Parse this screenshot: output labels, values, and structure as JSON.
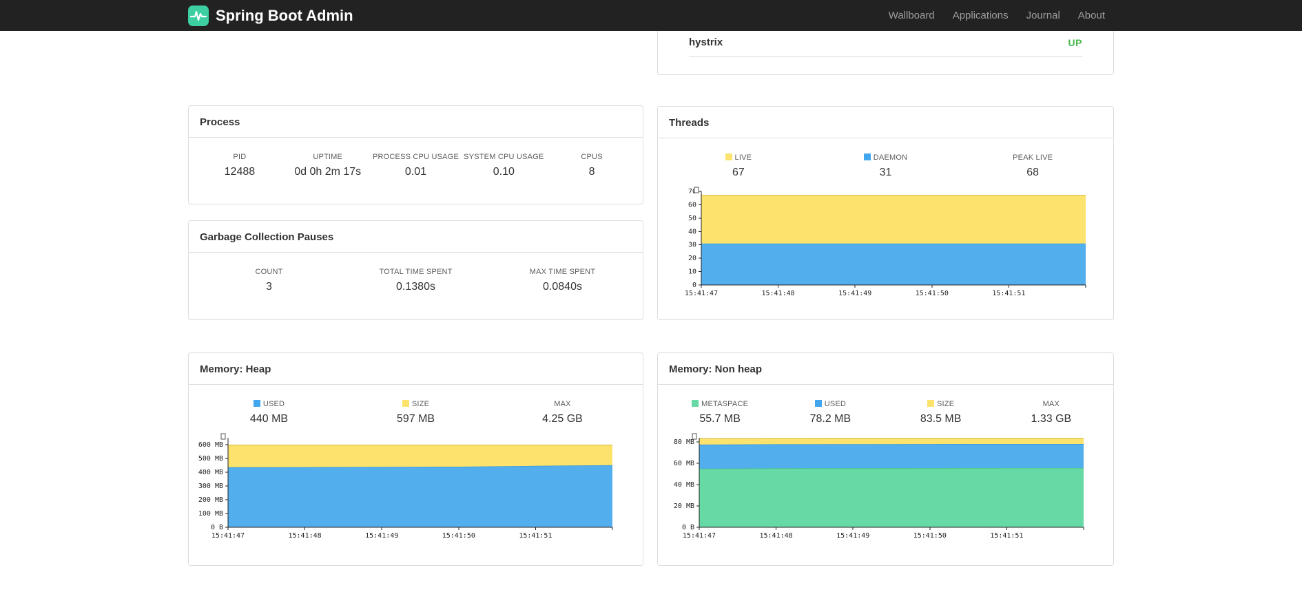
{
  "navbar": {
    "brand": "Spring Boot Admin",
    "links": [
      {
        "label": "Wallboard"
      },
      {
        "label": "Applications"
      },
      {
        "label": "Journal"
      },
      {
        "label": "About"
      }
    ]
  },
  "applications": {
    "rows": [
      {
        "name": "hystrix",
        "status": "UP",
        "status_color": "#45b847"
      }
    ]
  },
  "panels": {
    "process": {
      "title": "Process",
      "stats": [
        {
          "label": "PID",
          "value": "12488"
        },
        {
          "label": "UPTIME",
          "value": "0d 0h 2m 17s"
        },
        {
          "label": "PROCESS CPU USAGE",
          "value": "0.01"
        },
        {
          "label": "SYSTEM CPU USAGE",
          "value": "0.10"
        },
        {
          "label": "CPUS",
          "value": "8"
        }
      ]
    },
    "gc": {
      "title": "Garbage Collection Pauses",
      "stats": [
        {
          "label": "COUNT",
          "value": "3"
        },
        {
          "label": "TOTAL TIME SPENT",
          "value": "0.1380s"
        },
        {
          "label": "MAX TIME SPENT",
          "value": "0.0840s"
        }
      ]
    },
    "threads": {
      "title": "Threads",
      "stats": [
        {
          "label": "LIVE",
          "value": "67",
          "swatch": "#fce36e"
        },
        {
          "label": "DAEMON",
          "value": "31",
          "swatch": "#41a6ee"
        },
        {
          "label": "PEAK LIVE",
          "value": "68"
        }
      ]
    },
    "heap": {
      "title": "Memory: Heap",
      "stats": [
        {
          "label": "USED",
          "value": "440 MB",
          "swatch": "#41a6ee"
        },
        {
          "label": "SIZE",
          "value": "597 MB",
          "swatch": "#fce36e"
        },
        {
          "label": "MAX",
          "value": "4.25 GB"
        }
      ]
    },
    "nonheap": {
      "title": "Memory: Non heap",
      "stats": [
        {
          "label": "METASPACE",
          "value": "55.7 MB",
          "swatch": "#66d9a4"
        },
        {
          "label": "USED",
          "value": "78.2 MB",
          "swatch": "#41a6ee"
        },
        {
          "label": "SIZE",
          "value": "83.5 MB",
          "swatch": "#fce36e"
        },
        {
          "label": "MAX",
          "value": "1.33 GB"
        }
      ]
    }
  },
  "chart_data": [
    {
      "id": "threads",
      "type": "area",
      "title": "Threads",
      "x_labels": [
        "15:41:47",
        "15:41:48",
        "15:41:49",
        "15:41:50",
        "15:41:51"
      ],
      "ylim": [
        0,
        70
      ],
      "y_ticks": [
        {
          "v": 0,
          "label": "0"
        },
        {
          "v": 10,
          "label": "10"
        },
        {
          "v": 20,
          "label": "20"
        },
        {
          "v": 30,
          "label": "30"
        },
        {
          "v": 40,
          "label": "40"
        },
        {
          "v": 50,
          "label": "50"
        },
        {
          "v": 60,
          "label": "60"
        },
        {
          "v": 70,
          "label": "70"
        }
      ],
      "series": [
        {
          "name": "daemon",
          "fill": "#52aeed",
          "stroke": "#3898db",
          "values": [
            31,
            31,
            31,
            31,
            31,
            31
          ]
        },
        {
          "name": "live",
          "fill": "#fce36e",
          "stroke": "#e3c85a",
          "values": [
            67,
            67,
            67,
            67,
            67,
            67
          ]
        }
      ]
    },
    {
      "id": "heap",
      "type": "area",
      "title": "Memory: Heap",
      "x_labels": [
        "15:41:47",
        "15:41:48",
        "15:41:49",
        "15:41:50",
        "15:41:51"
      ],
      "ylim": [
        0,
        650
      ],
      "y_ticks": [
        {
          "v": 0,
          "label": "0 B"
        },
        {
          "v": 100,
          "label": "100 MB"
        },
        {
          "v": 200,
          "label": "200 MB"
        },
        {
          "v": 300,
          "label": "300 MB"
        },
        {
          "v": 400,
          "label": "400 MB"
        },
        {
          "v": 500,
          "label": "500 MB"
        },
        {
          "v": 600,
          "label": "600 MB"
        }
      ],
      "series": [
        {
          "name": "used",
          "fill": "#52aeed",
          "stroke": "#3898db",
          "values": [
            436,
            437,
            439,
            440,
            446,
            451
          ]
        },
        {
          "name": "size",
          "fill": "#fce36e",
          "stroke": "#e3c85a",
          "values": [
            597,
            597,
            597,
            597,
            597,
            597
          ]
        }
      ]
    },
    {
      "id": "nonheap",
      "type": "area",
      "title": "Memory: Non heap",
      "x_labels": [
        "15:41:47",
        "15:41:48",
        "15:41:49",
        "15:41:50",
        "15:41:51"
      ],
      "ylim": [
        0,
        84
      ],
      "y_ticks": [
        {
          "v": 0,
          "label": "0 B"
        },
        {
          "v": 20,
          "label": "20 MB"
        },
        {
          "v": 40,
          "label": "40 MB"
        },
        {
          "v": 60,
          "label": "60 MB"
        },
        {
          "v": 80,
          "label": "80 MB"
        }
      ],
      "series": [
        {
          "name": "metaspace",
          "fill": "#66d9a4",
          "stroke": "#46c389",
          "values": [
            55.0,
            55.4,
            55.5,
            55.6,
            55.7,
            55.7
          ]
        },
        {
          "name": "used",
          "fill": "#52aeed",
          "stroke": "#3898db",
          "values": [
            77.6,
            77.9,
            78.0,
            78.1,
            78.2,
            78.2
          ]
        },
        {
          "name": "size",
          "fill": "#fce36e",
          "stroke": "#e3c85a",
          "values": [
            83.2,
            83.4,
            83.5,
            83.5,
            83.5,
            83.5
          ]
        }
      ]
    }
  ]
}
